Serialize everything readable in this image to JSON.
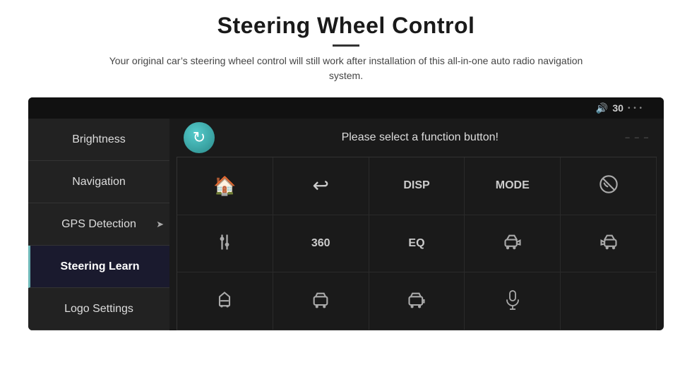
{
  "header": {
    "title": "Steering Wheel Control",
    "subtitle": "Your original car’s steering wheel control will still work after installation of this all-in-one auto radio navigation system."
  },
  "panel": {
    "volume_icon": "🔊",
    "volume_value": "30",
    "prompt_text": "Please select a function button!",
    "refresh_label": "refresh"
  },
  "sidebar": {
    "items": [
      {
        "label": "Brightness",
        "active": false
      },
      {
        "label": "Navigation",
        "active": false
      },
      {
        "label": "GPS Detection",
        "active": false
      },
      {
        "label": "Steering Learn",
        "active": true
      },
      {
        "label": "Logo Settings",
        "active": false
      }
    ]
  },
  "grid": {
    "rows": [
      [
        {
          "type": "icon",
          "icon": "🏠",
          "label": "home"
        },
        {
          "type": "icon",
          "icon": "↩",
          "label": "back"
        },
        {
          "type": "text",
          "value": "DISP",
          "label": "disp"
        },
        {
          "type": "text",
          "value": "MODE",
          "label": "mode"
        },
        {
          "type": "icon",
          "icon": "🚫",
          "label": "phone-off"
        }
      ],
      [
        {
          "type": "icon",
          "icon": "🎚",
          "label": "equalizer"
        },
        {
          "type": "text",
          "value": "360",
          "label": "360"
        },
        {
          "type": "text",
          "value": "EQ",
          "label": "eq"
        },
        {
          "type": "icon",
          "icon": "🚗",
          "label": "car-left"
        },
        {
          "type": "icon",
          "icon": "🚗",
          "label": "car-right"
        }
      ],
      [
        {
          "type": "icon",
          "icon": "🚗",
          "label": "car-top"
        },
        {
          "type": "icon",
          "icon": "🚗",
          "label": "car-2"
        },
        {
          "type": "icon",
          "icon": "🚗",
          "label": "car-3"
        },
        {
          "type": "icon",
          "icon": "🎤",
          "label": "mic"
        },
        {
          "type": "empty",
          "label": "empty"
        }
      ]
    ]
  }
}
